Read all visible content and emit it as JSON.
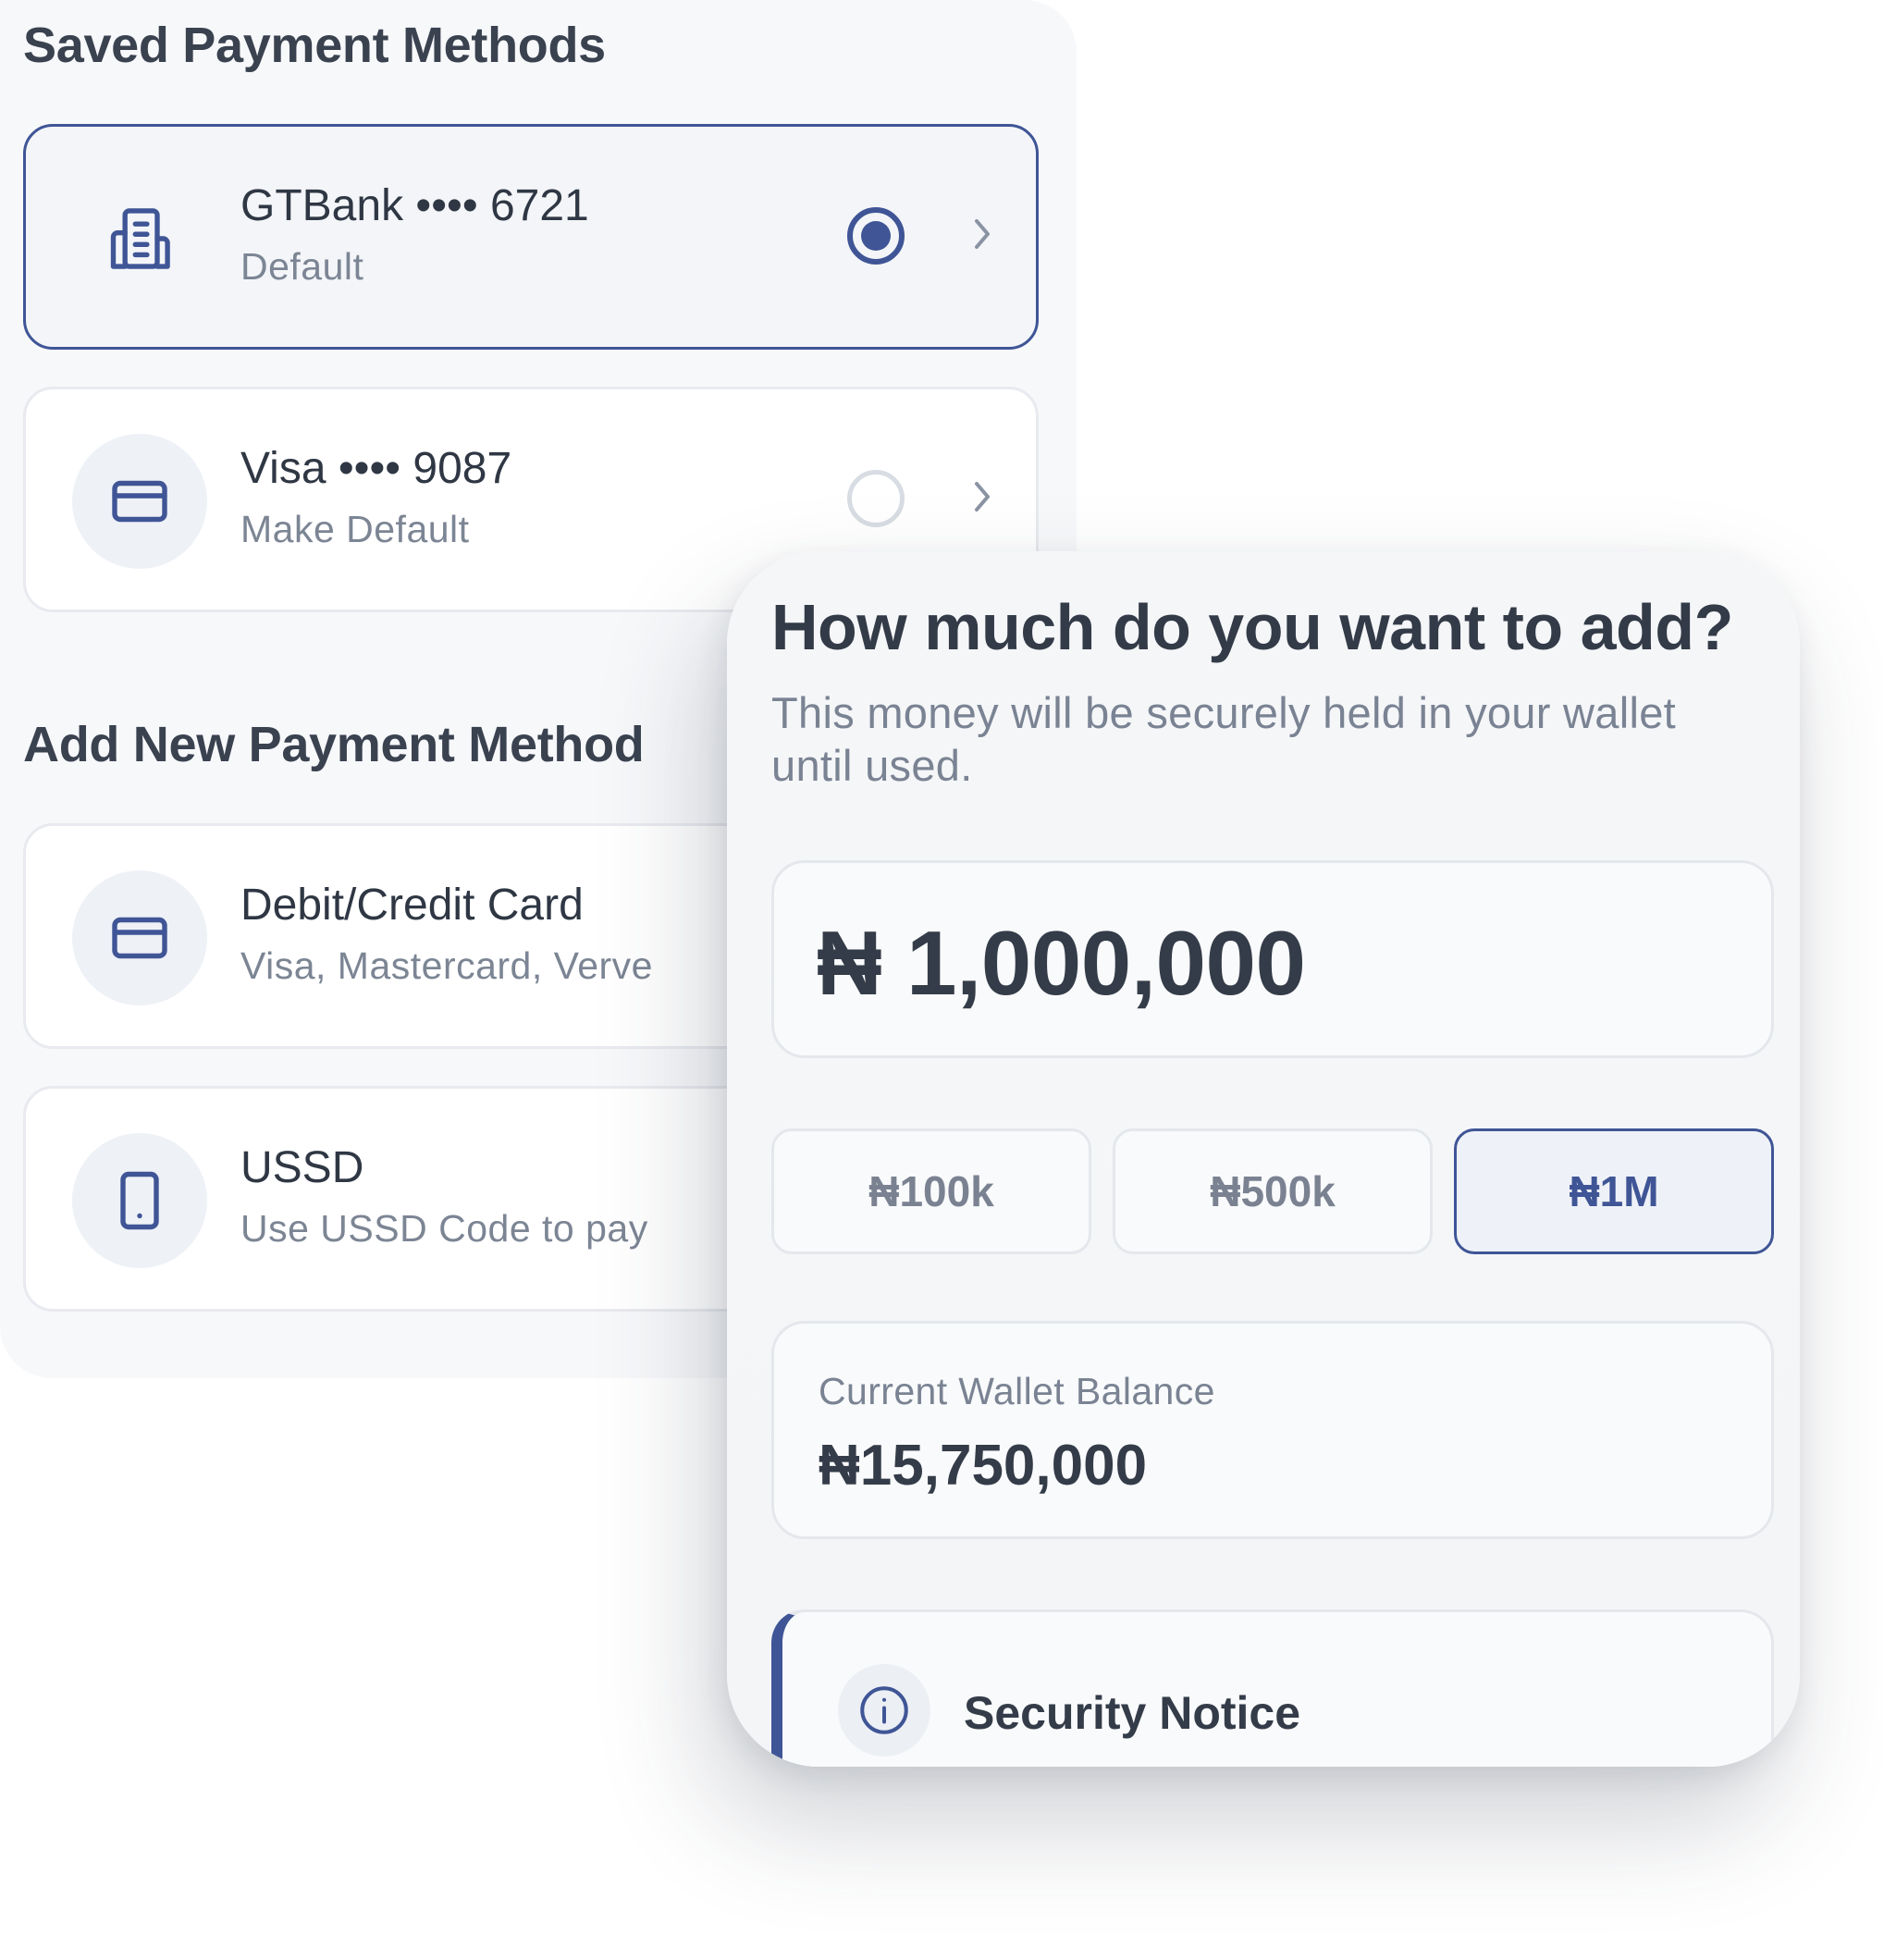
{
  "colors": {
    "accent": "#3f5596",
    "text_primary": "#343c49",
    "text_secondary": "#7a8393",
    "card_bg": "#ffffff",
    "panel_bg": "#f7f8fa"
  },
  "saved_section": {
    "title": "Saved Payment Methods",
    "methods": [
      {
        "icon": "bank-building-icon",
        "title": "GTBank •••• 6721",
        "subtitle": "Default",
        "selected": true
      },
      {
        "icon": "credit-card-icon",
        "title": "Visa •••• 9087",
        "subtitle": "Make Default",
        "selected": false
      }
    ]
  },
  "add_section": {
    "title": "Add New Payment Method",
    "options": [
      {
        "icon": "credit-card-icon",
        "title": "Debit/Credit Card",
        "subtitle": "Visa, Mastercard, Verve"
      },
      {
        "icon": "mobile-phone-icon",
        "title": "USSD",
        "subtitle": "Use USSD Code to pay"
      }
    ]
  },
  "topup": {
    "title": "How much do you want to add?",
    "description": "This money will be securely held in your wallet until used.",
    "amount": "₦ 1,000,000",
    "presets": [
      {
        "label": "₦100k",
        "active": false
      },
      {
        "label": "₦500k",
        "active": false
      },
      {
        "label": "₦1M",
        "active": true
      }
    ],
    "balance_label": "Current Wallet Balance",
    "balance_value": "₦15,750,000",
    "notice_title": "Security Notice"
  }
}
